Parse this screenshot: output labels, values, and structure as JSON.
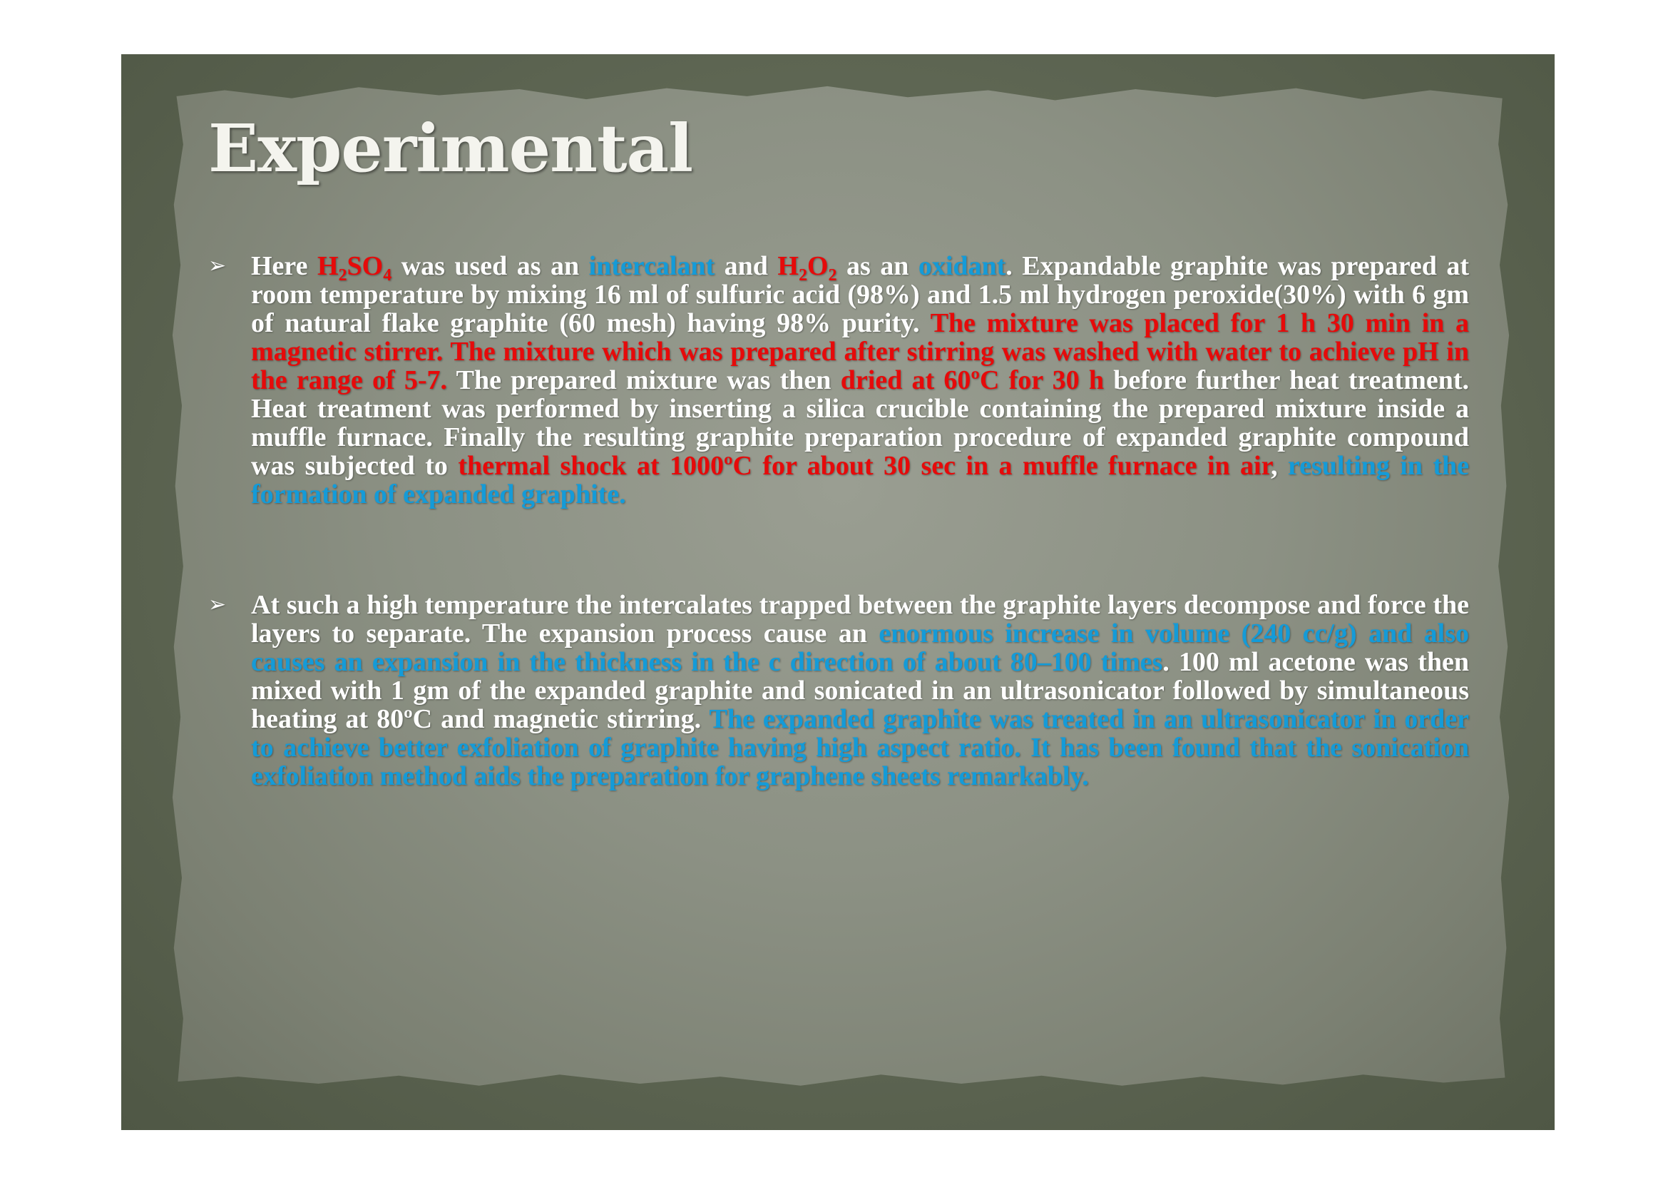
{
  "slide": {
    "title": "Experimental",
    "bullet_marker": "➢",
    "bullets": [
      {
        "segments": [
          {
            "text": "Here ",
            "style": "white"
          },
          {
            "text": "H",
            "style": "red"
          },
          {
            "text": "2",
            "style": "red-sub"
          },
          {
            "text": "SO",
            "style": "red"
          },
          {
            "text": "4",
            "style": "red-sub"
          },
          {
            "text": " was used as an ",
            "style": "white"
          },
          {
            "text": "intercalant",
            "style": "blue"
          },
          {
            "text": " and ",
            "style": "white"
          },
          {
            "text": "H",
            "style": "red"
          },
          {
            "text": "2",
            "style": "red-sub"
          },
          {
            "text": "O",
            "style": "red"
          },
          {
            "text": "2",
            "style": "red-sub"
          },
          {
            "text": " as an ",
            "style": "white"
          },
          {
            "text": "oxidant",
            "style": "blue"
          },
          {
            "text": ". Expandable graphite was prepared at room temperature by mixing 16 ml of sulfuric acid (98%) and 1.5 ml hydrogen peroxide(30%) with 6 gm of natural flake graphite (60 mesh) having 98% purity. ",
            "style": "white"
          },
          {
            "text": "The mixture was placed for 1 h 30 min in a magnetic stirrer. The mixture which was prepared after stirring was washed with water to achieve pH in the range of 5-7.",
            "style": "red"
          },
          {
            "text": " The prepared mixture was then ",
            "style": "white"
          },
          {
            "text": "dried at 60ºC for 30 h",
            "style": "red"
          },
          {
            "text": " before further heat treatment. Heat treatment was performed by inserting a silica crucible containing the prepared mixture inside a muffle furnace. Finally the resulting graphite preparation procedure of expanded graphite compound was subjected to ",
            "style": "white"
          },
          {
            "text": "thermal shock at 1000ºC for about 30 sec in a muffle furnace in air",
            "style": "red"
          },
          {
            "text": ", ",
            "style": "white"
          },
          {
            "text": "resulting in the formation of expanded graphite.",
            "style": "blue"
          }
        ]
      },
      {
        "segments": [
          {
            "text": "At such a high temperature the intercalates trapped between the graphite layers decompose and force the layers to separate. The expansion process cause an ",
            "style": "white"
          },
          {
            "text": "enormous increase in volume (240 cc/g) and also causes an expansion in the thickness in the c direction of about 80–100 times",
            "style": "blue"
          },
          {
            "text": ". 100 ml acetone was then mixed with 1 gm of the expanded graphite and sonicated in an ultrasonicator followed by simultaneous heating at 80ºC and magnetic stirring. ",
            "style": "white"
          },
          {
            "text": "The expanded graphite was treated in an ultrasonicator in order to achieve better exfoliation of graphite having high aspect ratio. It has been found that the sonication exfoliation method aids the preparation for graphene sheets remarkably.",
            "style": "blue"
          }
        ]
      }
    ]
  },
  "colors": {
    "background": "#5d6552",
    "paper": "#8c9184",
    "title": "#f4f4ee",
    "body_text": "#ffffff",
    "highlight_red": "#e60a0a",
    "highlight_blue": "#149bd8"
  }
}
